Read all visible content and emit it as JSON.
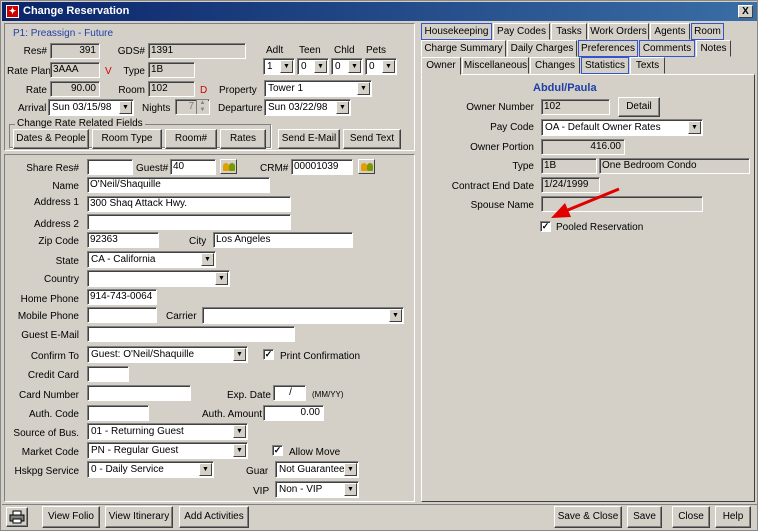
{
  "window": {
    "title": "Change Reservation",
    "close": "X"
  },
  "res": {
    "status": "P1: Preassign - Future",
    "res_label": "Res#",
    "res_value": "391",
    "gds_label": "GDS#",
    "gds_value": "1391",
    "rateplan_label": "Rate Plan",
    "rateplan_value": "3AAA",
    "rateplan_flag": "V",
    "type_label": "Type",
    "type_value": "1B",
    "rate_label": "Rate",
    "rate_value": "90.00",
    "room_label": "Room",
    "room_value": "102",
    "room_flag": "D",
    "property_label": "Property",
    "property_value": "Tower 1",
    "arrival_label": "Arrival",
    "arrival_value": "Sun 03/15/98",
    "nights_label": "Nights",
    "nights_value": "7",
    "departure_label": "Departure",
    "departure_value": "Sun 03/22/98",
    "occ": {
      "adlt_label": "Adlt",
      "adlt_value": "1",
      "teen_label": "Teen",
      "teen_value": "0",
      "chld_label": "Chld",
      "chld_value": "0",
      "pets_label": "Pets",
      "pets_value": "0"
    },
    "group_label": "Change Rate Related Fields",
    "btn_dates": "Dates & People",
    "btn_roomtype": "Room Type",
    "btn_roomno": "Room#",
    "btn_rates": "Rates",
    "btn_email": "Send E-Mail",
    "btn_text": "Send Text"
  },
  "guest": {
    "share_label": "Share Res#",
    "share_value": "",
    "guest_label": "Guest#",
    "guest_value": "40",
    "crm_label": "CRM#",
    "crm_value": "00001039",
    "name_label": "Name",
    "name_value": "O'Neil/Shaquille",
    "addr1_label": "Address 1",
    "addr1_value": "300 Shaq Attack Hwy.",
    "addr2_label": "Address 2",
    "addr2_value": "",
    "zip_label": "Zip Code",
    "zip_value": "92363",
    "city_label": "City",
    "city_value": "Los Angeles",
    "state_label": "State",
    "state_value": "CA - California",
    "country_label": "Country",
    "country_value": "",
    "home_label": "Home Phone",
    "home_value": "914-743-0064",
    "mobile_label": "Mobile Phone",
    "mobile_value": "",
    "carrier_label": "Carrier",
    "carrier_value": "",
    "email_label": "Guest E-Mail",
    "email_value": "",
    "confirm_label": "Confirm To",
    "confirm_value": "Guest: O'Neil/Shaquille",
    "print_conf_label": "Print Confirmation",
    "print_conf_checked": "✓",
    "cc_label": "Credit Card",
    "cc_value": "",
    "cardno_label": "Card Number",
    "cardno_value": "",
    "exp_label": "Exp. Date",
    "exp_value": "/",
    "exp_hint": "(MM/YY)",
    "auth_label": "Auth. Code",
    "auth_value": "",
    "authamt_label": "Auth. Amount",
    "authamt_value": "0.00",
    "source_label": "Source of Bus.",
    "source_value": "01 - Returning Guest",
    "market_label": "Market Code",
    "market_value": "PN - Regular Guest",
    "allow_move_label": "Allow Move",
    "allow_move_checked": "✓",
    "hskpg_label": "Hskpg Service",
    "hskpg_value": "0 - Daily Service",
    "guar_label": "Guar",
    "guar_value": "Not Guaranteed",
    "vip_label": "VIP",
    "vip_value": "Non - VIP"
  },
  "tabs": {
    "row1": [
      "Housekeeping",
      "Pay Codes",
      "Tasks",
      "Work Orders",
      "Agents",
      "Room"
    ],
    "row2": [
      "Charge Summary",
      "Daily Charges",
      "Preferences",
      "Comments",
      "Notes"
    ],
    "row3": [
      "Owner",
      "Miscellaneous",
      "Changes",
      "Statistics",
      "Texts"
    ]
  },
  "owner": {
    "name": "Abdul/Paula",
    "number_label": "Owner Number",
    "number_value": "102",
    "detail_btn": "Detail",
    "paycode_label": "Pay Code",
    "paycode_value": "OA - Default Owner Rates",
    "portion_label": "Owner Portion",
    "portion_value": "416.00",
    "type_label": "Type",
    "type_code": "1B",
    "type_desc": "One Bedroom Condo",
    "contract_label": "Contract End Date",
    "contract_value": "1/24/1999",
    "spouse_label": "Spouse Name",
    "spouse_value": "",
    "pooled_label": "Pooled Reservation",
    "pooled_checked": "✓"
  },
  "bottom": {
    "print_icon": "printer-icon",
    "view_folio": "View Folio",
    "view_itinerary": "View Itinerary",
    "add_activities": "Add Activities",
    "save_close": "Save & Close",
    "save": "Save",
    "close": "Close",
    "help": "Help"
  },
  "colors": {
    "title_bar": "#0a246a",
    "window_bg": "#d4d0c8",
    "heading_blue": "#1f3fa8",
    "flag_red": "#d00000",
    "arrow_red": "#e00000"
  }
}
